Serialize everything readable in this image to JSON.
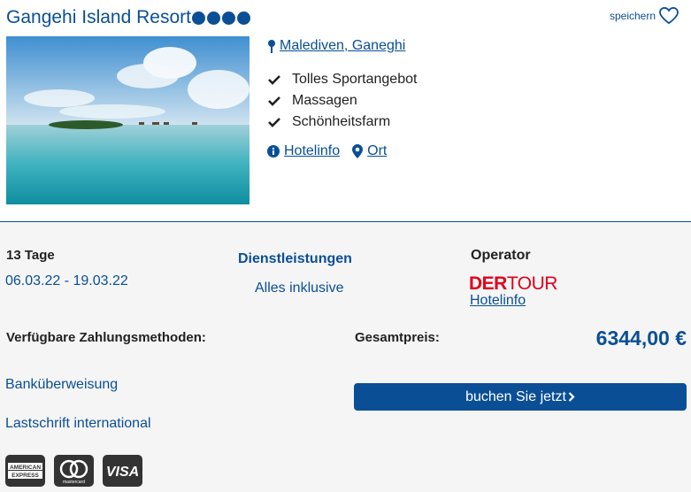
{
  "hotel": {
    "name": "Gangehi Island Resort",
    "stars": 4,
    "save_label": "speichern",
    "location": "Malediven, Ganeghi",
    "features": [
      "Tolles Sportangebot",
      "Massagen",
      "Schönheitsfarm"
    ],
    "hotelinfo_link": "Hotelinfo",
    "ort_link": "Ort"
  },
  "offer": {
    "duration": "13 Tage",
    "dates": "06.03.22 - 19.03.22",
    "services_heading": "Dienstleistungen",
    "services_value": "Alles inklusive",
    "operator_heading": "Operator",
    "operator_logo": {
      "part1": "DER",
      "part2": "TOUR"
    },
    "operator_link": "Hotelinfo"
  },
  "payment": {
    "heading": "Verfügbare Zahlungsmethoden:",
    "methods": [
      "Banküberweisung",
      "Lastschrift international"
    ],
    "card_icons": [
      "american-express-icon",
      "mastercard-icon",
      "visa-icon"
    ],
    "card_texts": {
      "amex_line1": "AMERICAN",
      "amex_line2": "EXPRESS",
      "mastercard": "mastercard",
      "visa": "VISA"
    }
  },
  "price": {
    "label": "Gesamtpreis:",
    "value": "6344,00 €"
  },
  "book_button": {
    "label": "buchen Sie jetzt"
  },
  "colors": {
    "primary": "#0a4f96",
    "brand_red": "#e2001a",
    "background": "#f5f5f5"
  }
}
